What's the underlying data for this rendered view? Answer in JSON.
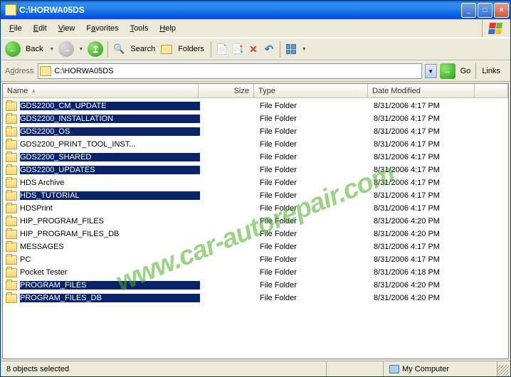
{
  "window": {
    "title": "C:\\HORWA05DS"
  },
  "titlebar_buttons": {
    "min": "_",
    "max": "□",
    "close": "×"
  },
  "menu": {
    "file": "File",
    "edit": "Edit",
    "view": "View",
    "favorites": "Favorites",
    "tools": "Tools",
    "help": "Help"
  },
  "toolbar": {
    "back_label": "Back",
    "search_label": "Search",
    "folders_label": "Folders"
  },
  "address": {
    "label": "Address",
    "path": "C:\\HORWA05DS",
    "go_label": "Go",
    "links_label": "Links"
  },
  "columns": {
    "name": "Name",
    "size": "Size",
    "type": "Type",
    "date": "Date Modified"
  },
  "type_folder": "File Folder",
  "files": [
    {
      "name": "GDS2200_CM_UPDATE",
      "date": "8/31/2006 4:17 PM",
      "sel": true
    },
    {
      "name": "GDS2200_INSTALLATION",
      "date": "8/31/2006 4:17 PM",
      "sel": true
    },
    {
      "name": "GDS2200_OS",
      "date": "8/31/2006 4:17 PM",
      "sel": true
    },
    {
      "name": "GDS2200_PRINT_TOOL_INST...",
      "date": "8/31/2006 4:17 PM",
      "sel": false
    },
    {
      "name": "GDS2200_SHARED",
      "date": "8/31/2006 4:17 PM",
      "sel": true
    },
    {
      "name": "GDS2200_UPDATES",
      "date": "8/31/2006 4:17 PM",
      "sel": true
    },
    {
      "name": "HDS Archive",
      "date": "8/31/2006 4:17 PM",
      "sel": false
    },
    {
      "name": "HDS_TUTORIAL",
      "date": "8/31/2006 4:17 PM",
      "sel": true
    },
    {
      "name": "HDSPrint",
      "date": "8/31/2006 4:17 PM",
      "sel": false
    },
    {
      "name": "HIP_PROGRAM_FILES",
      "date": "8/31/2006 4:20 PM",
      "sel": false
    },
    {
      "name": "HIP_PROGRAM_FILES_DB",
      "date": "8/31/2006 4:20 PM",
      "sel": false
    },
    {
      "name": "MESSAGES",
      "date": "8/31/2006 4:17 PM",
      "sel": false
    },
    {
      "name": "PC",
      "date": "8/31/2006 4:17 PM",
      "sel": false
    },
    {
      "name": "Pocket Tester",
      "date": "8/31/2006 4:18 PM",
      "sel": false
    },
    {
      "name": "PROGRAM_FILES",
      "date": "8/31/2006 4:20 PM",
      "sel": true
    },
    {
      "name": "PROGRAM_FILES_DB",
      "date": "8/31/2006 4:20 PM",
      "sel": true
    }
  ],
  "status": {
    "selection": "8 objects selected",
    "location": "My Computer"
  },
  "watermark": "www.car-autorepair.com"
}
